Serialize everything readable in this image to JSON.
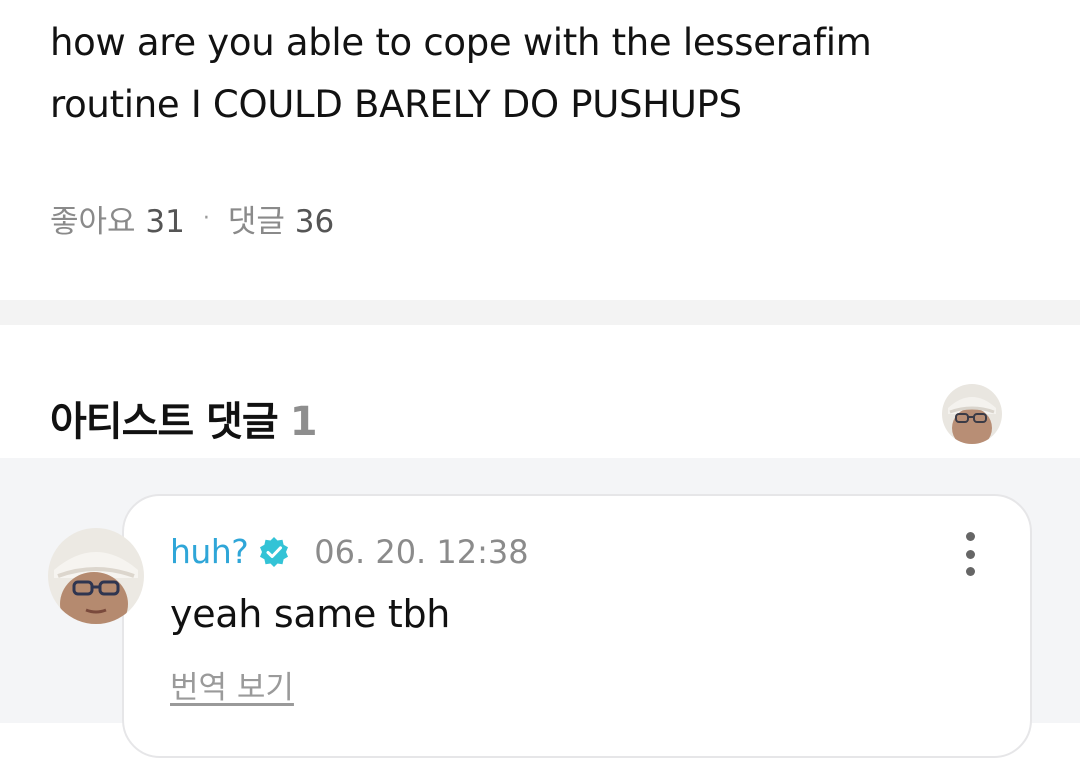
{
  "post": {
    "text_line1": "how are you able to cope with the lesserafim",
    "text_line2": "routine I COULD BARELY DO PUSHUPS",
    "likes_label": "좋아요",
    "likes_count": "31",
    "separator": "·",
    "comments_label": "댓글",
    "comments_count": "36"
  },
  "artist_comments": {
    "title": "아티스트 댓글",
    "count": "1"
  },
  "comment": {
    "author": "huh?",
    "timestamp": "06. 20. 12:38",
    "body": "yeah same tbh",
    "translate_label": "번역 보기",
    "verified_color": "#33c3d6",
    "author_color": "#2fa6d8"
  },
  "icons": {
    "verified": "verified-badge-icon",
    "more": "more-vertical-icon"
  }
}
